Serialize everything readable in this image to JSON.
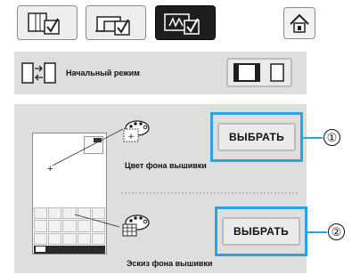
{
  "tabs": [
    {
      "name": "tab-settings-general",
      "icon": "page-check-icon"
    },
    {
      "name": "tab-settings-sewing",
      "icon": "machine-check-icon"
    },
    {
      "name": "tab-settings-embroidery",
      "icon": "embroidery-check-icon",
      "active": true
    }
  ],
  "home_icon": "home-icon",
  "start_mode": {
    "label": "Начальный режим"
  },
  "background": {
    "color_button": "ВЫБРАТЬ",
    "color_label": "Цвет фона вышивки",
    "thumb_button": "ВЫБРАТЬ",
    "thumb_label": "Эскиз фона вышивки"
  },
  "callouts": [
    "①",
    "②"
  ],
  "colors": {
    "highlight": "#2aa3e0",
    "panel": "#dedede",
    "active_tab": "#1e1e1e"
  }
}
